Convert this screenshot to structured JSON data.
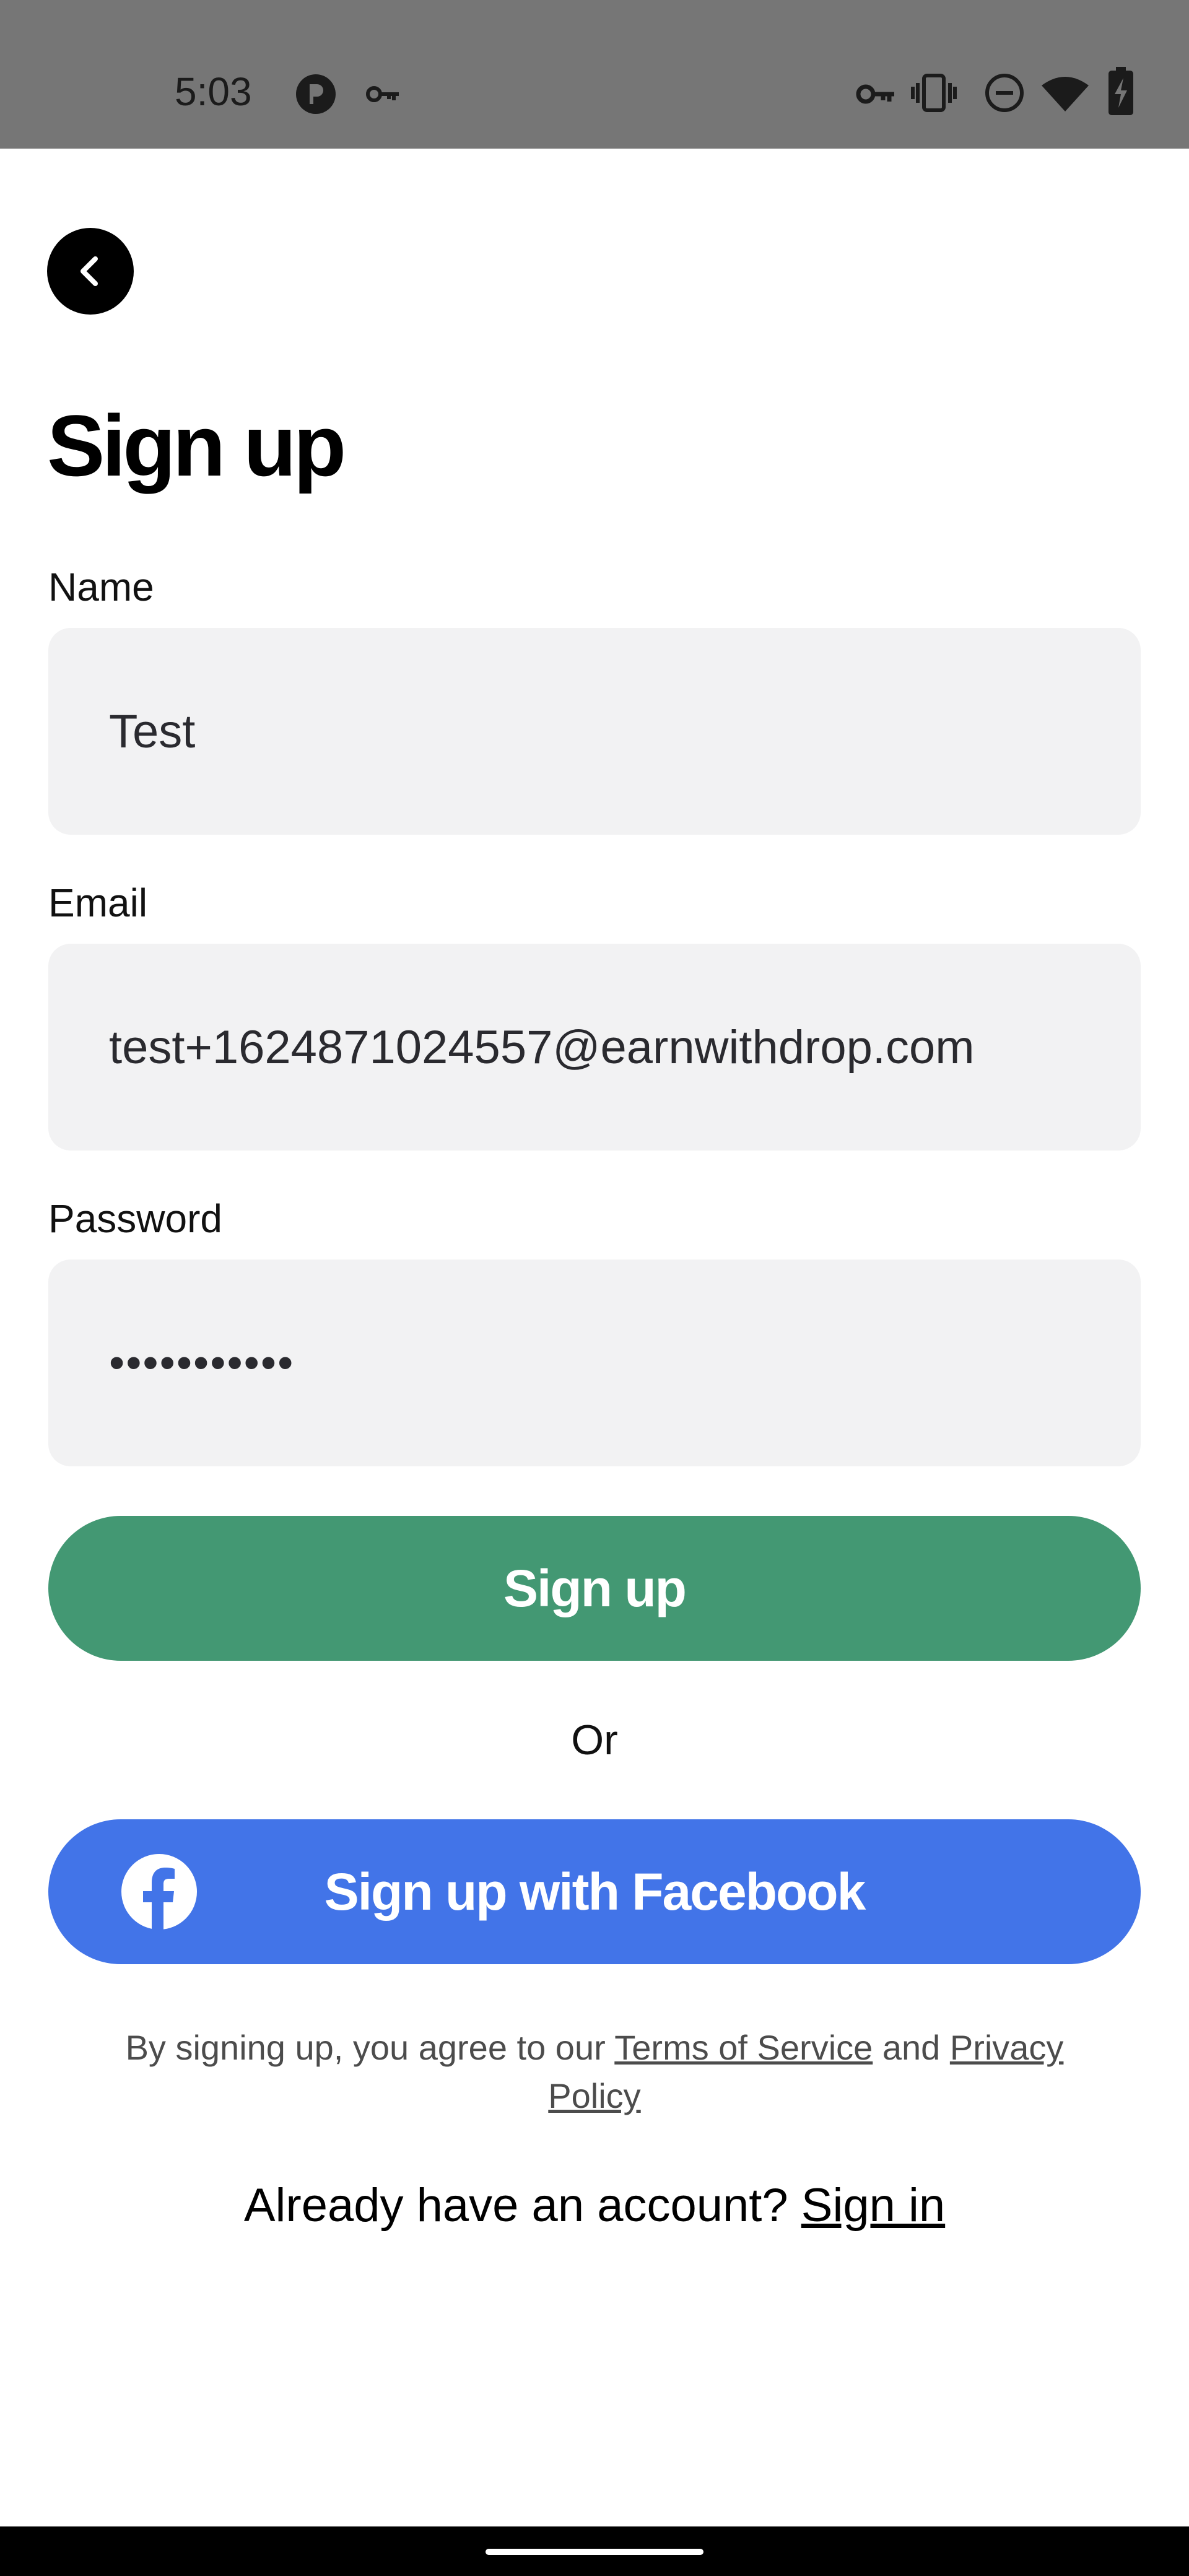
{
  "status_bar": {
    "time": "5:03",
    "left_icons": [
      "app-badge-icon",
      "key-icon"
    ],
    "right_icons": [
      "vpn-key-icon",
      "vibrate-icon",
      "do-not-disturb-icon",
      "wifi-icon",
      "battery-charging-icon"
    ],
    "background": "#767676"
  },
  "header": {
    "back_icon": "chevron-left-icon",
    "title": "Sign up"
  },
  "form": {
    "name": {
      "label": "Name",
      "value": "Test"
    },
    "email": {
      "label": "Email",
      "value": "test+1624871024557@earnwithdrop.com"
    },
    "password": {
      "label": "Password",
      "value": "•••••••••••"
    }
  },
  "actions": {
    "signup_label": "Sign up",
    "signup_color": "#439873",
    "or_label": "Or",
    "facebook_label": "Sign up with Facebook",
    "facebook_color": "#4274e8",
    "facebook_icon": "facebook-icon"
  },
  "legal": {
    "prefix": "By signing up, you agree to our ",
    "terms_link": "Terms of Service",
    "middle": " and ",
    "privacy_link": "Privacy Policy"
  },
  "footer": {
    "prompt": "Already have an account? ",
    "signin_link": "Sign in"
  }
}
